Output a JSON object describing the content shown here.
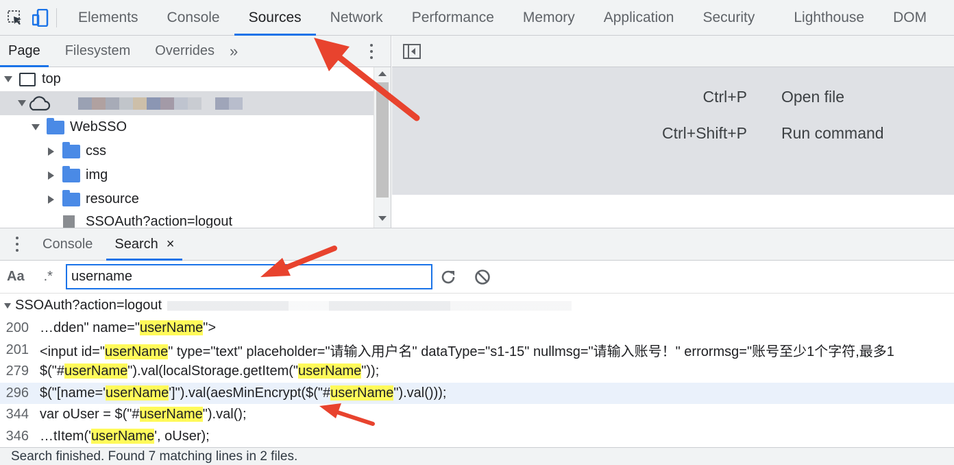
{
  "devtools_tabs": [
    "Elements",
    "Console",
    "Sources",
    "Network",
    "Performance",
    "Memory",
    "Application",
    "Security",
    "Lighthouse",
    "DOM"
  ],
  "active_tab": "Sources",
  "navigator": {
    "tabs": [
      "Page",
      "Filesystem",
      "Overrides"
    ],
    "more": "»",
    "tree": {
      "top": "top",
      "folder_websso": "WebSSO",
      "folder_css": "css",
      "folder_img": "img",
      "folder_resource": "resource",
      "file_partial": "SSOAuth?action=logout"
    }
  },
  "editor": {
    "shortcut1_key": "Ctrl+P",
    "shortcut1_action": "Open file",
    "shortcut2_key": "Ctrl+Shift+P",
    "shortcut2_action": "Run command"
  },
  "drawer": {
    "tab_console": "Console",
    "tab_search": "Search",
    "close": "×"
  },
  "search": {
    "match_case": "Aa",
    "regex": ".*",
    "query": "username"
  },
  "results": {
    "file": "SSOAuth?action=logout",
    "lines": [
      {
        "num": "200",
        "pre": "…dden\" name=\"",
        "m1": "userName",
        "mid": "\">",
        "m2": "",
        "post": ""
      },
      {
        "num": "201",
        "pre": "<input id=\"",
        "m1": "userName",
        "mid": "\" type=\"text\" placeholder=\"请输入用户名\" dataType=\"s1-15\" nullmsg=\"请输入账号！\" errormsg=\"账号至少1个字符,最多1",
        "m2": "",
        "post": ""
      },
      {
        "num": "279",
        "pre": "$(\"#",
        "m1": "userName",
        "mid": "\").val(localStorage.getItem(\"",
        "m2": "userName",
        "post": "\"));"
      },
      {
        "num": "296",
        "pre": "$(\"[name='",
        "m1": "userName",
        "mid": "']\").val(aesMinEncrypt($(\"#",
        "m2": "userName",
        "post": "\").val()));"
      },
      {
        "num": "344",
        "pre": "var oUser = $(\"#",
        "m1": "userName",
        "mid": "\").val();",
        "m2": "",
        "post": ""
      },
      {
        "num": "346",
        "pre": "…tItem('",
        "m1": "userName",
        "mid": "', oUser);",
        "m2": "",
        "post": ""
      }
    ]
  },
  "status": "Search finished.  Found 7 matching lines in 2 files.",
  "colors": {
    "accent": "#1a73e8",
    "highlight": "#fffa5a",
    "arrow": "#e8432e",
    "folder": "#4a8ae6"
  }
}
